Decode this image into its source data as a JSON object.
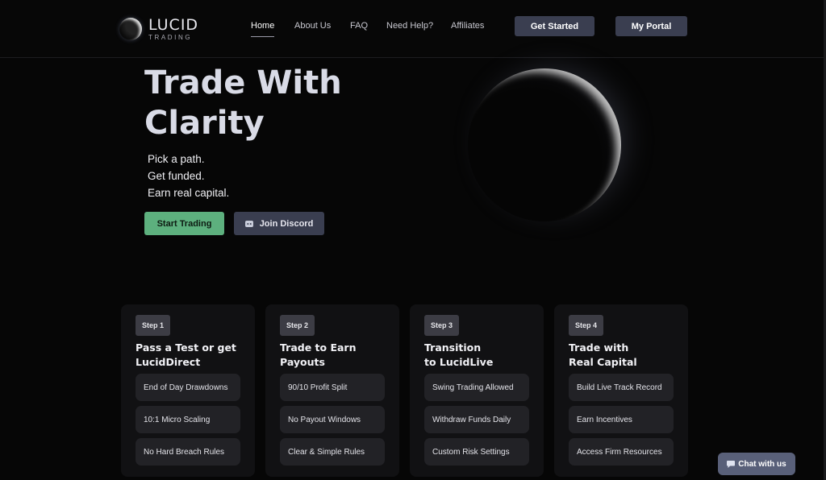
{
  "logo": {
    "main": "LUCID",
    "sub": "TRADING"
  },
  "nav": {
    "items": [
      {
        "label": "Home"
      },
      {
        "label": "About Us"
      },
      {
        "label": "FAQ"
      },
      {
        "label": "Need Help?"
      },
      {
        "label": "Affiliates"
      }
    ],
    "active": "Home",
    "get_started": "Get Started",
    "my_portal": "My Portal"
  },
  "hero": {
    "title": "Trade With Clarity",
    "taglines": [
      "Pick a path.",
      "Get funded.",
      "Earn real capital."
    ],
    "start_trading": "Start Trading",
    "join_discord": "Join Discord"
  },
  "steps": [
    {
      "badge": "Step 1",
      "title": "Pass a Test or get\nLucidDirect",
      "features": [
        "End of Day Drawdowns",
        "10:1 Micro Scaling",
        "No Hard Breach Rules"
      ]
    },
    {
      "badge": "Step 2",
      "title": "Trade to Earn\nPayouts",
      "features": [
        "90/10 Profit Split",
        "No Payout Windows",
        "Clear & Simple Rules"
      ]
    },
    {
      "badge": "Step 3",
      "title": "Transition\nto LucidLive",
      "features": [
        "Swing Trading Allowed",
        "Withdraw Funds Daily",
        "Custom Risk Settings"
      ]
    },
    {
      "badge": "Step 4",
      "title": "Trade with\nReal Capital",
      "features": [
        "Build Live Track Record",
        "Earn Incentives",
        "Access Firm Resources"
      ]
    }
  ],
  "chat": {
    "label": "Chat with us"
  },
  "colors": {
    "accent_green": "#5db07e",
    "button_slate": "#3a3e50",
    "background": "#060606"
  },
  "icons": {
    "discord": "discord-icon",
    "chat": "chat-bubble-icon",
    "logo": "planet-orb-icon"
  }
}
